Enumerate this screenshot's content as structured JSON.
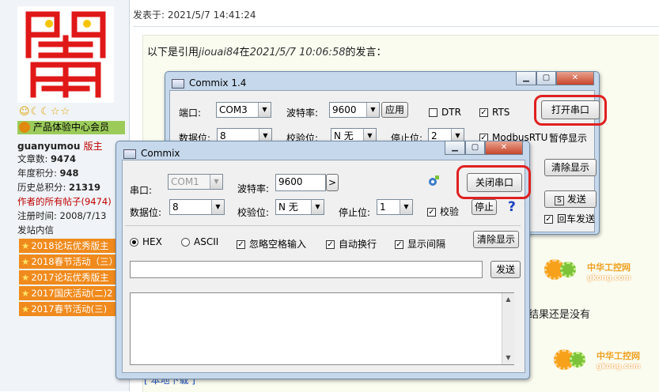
{
  "post": {
    "header": "发表于: 2021/5/7 14:41:24",
    "quote_prefix": "以下是引用",
    "quote_user": "jiouai84",
    "quote_mid": "在",
    "quote_time": "2021/5/7 10:06:58",
    "quote_suffix": "的发言：",
    "tail_text": "结果还是没有",
    "bottom_link": "[ 本地下载 ]"
  },
  "user": {
    "stars": "☺☾☾☆☆",
    "group": "产品体验中心会员",
    "name": "guanyumou",
    "role": "版主",
    "stats": [
      {
        "label": "文章数:",
        "value": "9474"
      },
      {
        "label": "年度积分:",
        "value": "948"
      },
      {
        "label": "历史总积分:",
        "value": "21319"
      }
    ],
    "all_posts": "作者的所有帖子(9474)",
    "reg": "注册时间: 2008/7/13",
    "msg": "发站内信",
    "badges": [
      "2018论坛优秀版主",
      "2018春节活动（三）",
      "2017论坛优秀版主",
      "2017国庆活动(二)2",
      "2017春节活动(三)"
    ]
  },
  "watermark": {
    "main": "中华工控网",
    "sub": "gkong.com"
  },
  "back_win": {
    "title": "Commix 1.4",
    "port_label": "端口:",
    "port_value": "COM3",
    "baud_label": "波特率:",
    "baud_value": "9600",
    "apply": "应用",
    "dtr": "DTR",
    "rts": "RTS",
    "open_port": "打开串口",
    "data_label": "数据位:",
    "data_value": "8",
    "parity_label": "校验位:",
    "parity_value": "N 无",
    "stop_label": "停止位:",
    "stop_value": "2",
    "modbus": "ModbusRTU",
    "pause": "暂停显示",
    "clear": "清除显示",
    "send": "发送",
    "send_icon": "S",
    "auto_cr": "回车发送"
  },
  "front_win": {
    "title": "Commix",
    "port_label": "串口:",
    "port_value": "COM1",
    "baud_label": "波特率:",
    "baud_value": "9600",
    "close_port": "关闭串口",
    "data_label": "数据位:",
    "data_value": "8",
    "parity_label": "校验位:",
    "parity_value": "N 无",
    "stop_label": "停止位:",
    "stop_value": "1",
    "check": "校验",
    "stop_btn": "停止",
    "help": "?",
    "hex": "HEX",
    "ascii": "ASCII",
    "ignore_space": "忽略空格输入",
    "auto_wrap": "自动换行",
    "show_interval": "显示间隔",
    "clear": "清除显示",
    "send": "发送"
  },
  "colors": {
    "accent_red": "#e02020",
    "badge_orange": "#f08a1c",
    "group_green": "#9ccb5a"
  }
}
